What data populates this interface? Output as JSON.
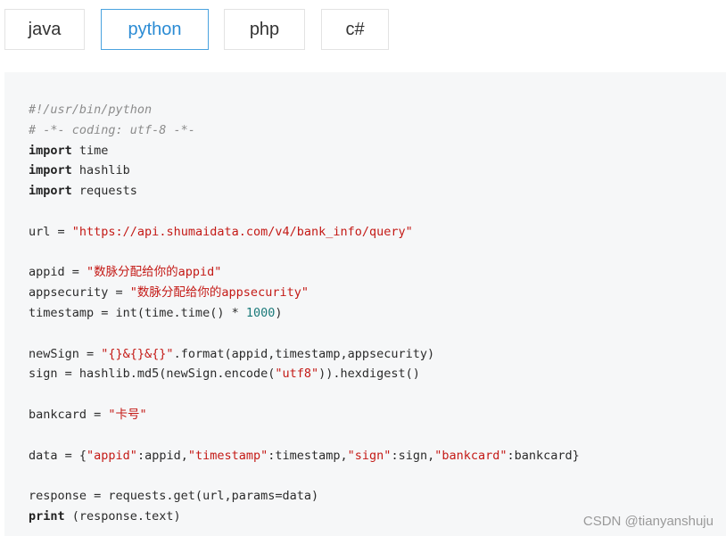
{
  "tabs": {
    "java": "java",
    "python": "python",
    "php": "php",
    "csharp": "c#",
    "active": "python"
  },
  "code": {
    "shebang": "#!/usr/bin/python",
    "coding": "# -*- coding: utf-8 -*-",
    "kw_import": "import",
    "kw_print": "print",
    "mod_time": " time",
    "mod_hashlib": " hashlib",
    "mod_requests": " requests",
    "url_lhs": "url = ",
    "url_value": "\"https://api.shumaidata.com/v4/bank_info/query\"",
    "appid_lhs": "appid = ",
    "appid_value": "\"数脉分配给你的appid\"",
    "appsecurity_lhs": "appsecurity = ",
    "appsecurity_value": "\"数脉分配给你的appsecurity\"",
    "timestamp_lhs": "timestamp = int(time.time() * ",
    "timestamp_num": "1000",
    "timestamp_rhs": ")",
    "newsign_lhs": "newSign = ",
    "newsign_fmt": "\"{}&{}&{}\"",
    "newsign_rhs": ".format(appid,timestamp,appsecurity)",
    "sign_lhs": "sign = hashlib.md5(newSign.encode(",
    "sign_str": "\"utf8\"",
    "sign_rhs": ")).hexdigest()",
    "bankcard_lhs": "bankcard = ",
    "bankcard_value": "\"卡号\"",
    "data_lhs": "data = {",
    "data_k1": "\"appid\"",
    "data_v1": ":appid,",
    "data_k2": "\"timestamp\"",
    "data_v2": ":timestamp,",
    "data_k3": "\"sign\"",
    "data_v3": ":sign,",
    "data_k4": "\"bankcard\"",
    "data_v4": ":bankcard}",
    "response_line": "response = requests.get(url,params=data)",
    "print_rhs": " (response.text)"
  },
  "watermark": "CSDN @tianyanshuju"
}
